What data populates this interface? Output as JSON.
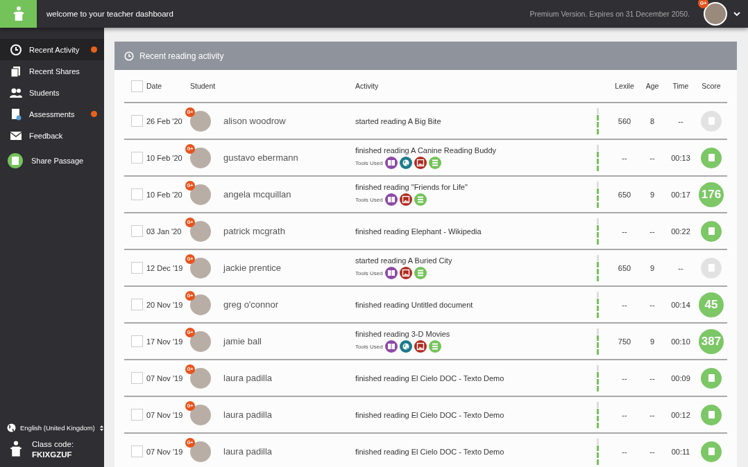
{
  "topbar": {
    "title": "welcome to your teacher dashboard",
    "license": "Premium Version. Expires on 31 December 2050.",
    "user_badge": "G+"
  },
  "sidebar": {
    "items": [
      {
        "label": "Recent Activity",
        "kind": "clock",
        "selected": true,
        "notification": true
      },
      {
        "label": "Recent Shares",
        "kind": "shares",
        "selected": false,
        "notification": false
      },
      {
        "label": "Students",
        "kind": "students",
        "selected": false,
        "notification": false
      },
      {
        "label": "Assessments",
        "kind": "assessment",
        "selected": false,
        "notification": true
      },
      {
        "label": "Feedback",
        "kind": "mail",
        "selected": false,
        "notification": false
      }
    ],
    "share_button": "Share Passage",
    "language": "English (United Kingdom)",
    "class_code_label": "Class code:",
    "class_code": "FKIXGZUF"
  },
  "panel": {
    "title": "Recent reading activity",
    "select_all_checked": false,
    "columns": [
      "Date",
      "Student",
      "Activity",
      "Lexile",
      "Age",
      "Time",
      "Score"
    ],
    "rows": [
      {
        "checked": false,
        "date": "26 Feb '20",
        "badge": "G+",
        "student": "alison woodrow",
        "activity": "started reading A Big Bite",
        "tools": [],
        "level": 0.75,
        "lexile": "560",
        "age": "8",
        "time": "--",
        "score": {
          "kind": "pending"
        }
      },
      {
        "checked": false,
        "date": "10 Feb '20",
        "badge": "G+",
        "student": "gustavo ebermann",
        "activity": "finished reading A Canine Reading Buddy",
        "tools_label": "Tools Used",
        "tools": [
          {
            "kind": "book"
          },
          {
            "kind": "globe"
          },
          {
            "kind": "picture"
          },
          {
            "kind": "list"
          }
        ],
        "level": 0.75,
        "lexile": "--",
        "age": "--",
        "time": "00:13",
        "score": {
          "kind": "done"
        }
      },
      {
        "checked": false,
        "date": "10 Feb '20",
        "badge": "G+",
        "student": "angela mcquillan",
        "activity": "finished reading \"Friends for Life\"",
        "tools_label": "Tools Used",
        "tools": [
          {
            "kind": "book"
          },
          {
            "kind": "picture"
          },
          {
            "kind": "list"
          }
        ],
        "level": 0.75,
        "lexile": "650",
        "age": "9",
        "time": "00:17",
        "score": {
          "kind": "number",
          "value": "176"
        }
      },
      {
        "checked": false,
        "date": "03 Jan '20",
        "badge": "G+",
        "student": "patrick mcgrath",
        "activity": "finished reading Elephant - Wikipedia",
        "tools": [],
        "level": 0.75,
        "lexile": "--",
        "age": "--",
        "time": "00:22",
        "score": {
          "kind": "done"
        }
      },
      {
        "checked": false,
        "date": "12 Dec '19",
        "badge": "G+",
        "student": "jackie prentice",
        "activity": "started reading A Buried City",
        "tools_label": "Tools Used",
        "tools": [
          {
            "kind": "book"
          },
          {
            "kind": "picture"
          },
          {
            "kind": "list"
          }
        ],
        "level": 0.75,
        "lexile": "650",
        "age": "9",
        "time": "--",
        "score": {
          "kind": "pending"
        }
      },
      {
        "checked": false,
        "date": "20 Nov '19",
        "badge": "G+",
        "student": "greg o'connor",
        "activity": "finished reading Untitled document",
        "tools": [],
        "level": 0.75,
        "lexile": "--",
        "age": "--",
        "time": "00:14",
        "score": {
          "kind": "number",
          "value": "45"
        }
      },
      {
        "checked": false,
        "date": "17 Nov '19",
        "badge": "G+",
        "student": "jamie ball",
        "activity": "finished reading 3-D Movies",
        "tools_label": "Tools Used",
        "tools": [
          {
            "kind": "book"
          },
          {
            "kind": "globe"
          },
          {
            "kind": "picture"
          },
          {
            "kind": "list"
          }
        ],
        "level": 0.75,
        "lexile": "750",
        "age": "9",
        "time": "00:10",
        "score": {
          "kind": "number",
          "value": "387"
        }
      },
      {
        "checked": false,
        "date": "07 Nov '19",
        "badge": "G+",
        "student": "laura padilla",
        "activity": "finished reading El Cielo DOC - Texto Demo",
        "tools": [],
        "level": 0.75,
        "lexile": "--",
        "age": "--",
        "time": "00:09",
        "score": {
          "kind": "done"
        }
      },
      {
        "checked": false,
        "date": "07 Nov '19",
        "badge": "G+",
        "student": "laura padilla",
        "activity": "finished reading El Cielo DOC - Texto Demo",
        "tools": [],
        "level": 0.75,
        "lexile": "--",
        "age": "--",
        "time": "00:12",
        "score": {
          "kind": "done"
        }
      },
      {
        "checked": false,
        "date": "07 Nov '19",
        "badge": "G+",
        "student": "laura padilla",
        "activity": "finished reading El Cielo DOC - Texto Demo",
        "tools": [],
        "level": 0.75,
        "lexile": "--",
        "age": "--",
        "time": "00:11",
        "score": {
          "kind": "done"
        }
      }
    ]
  }
}
